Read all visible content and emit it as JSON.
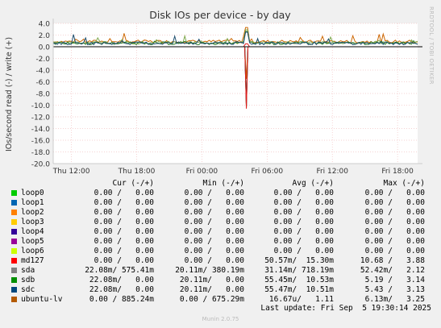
{
  "chart_data": {
    "type": "line",
    "title": "Disk IOs per device - by day",
    "ylabel": "IOs/second read (-) / write (+)",
    "ylim": [
      -20,
      4
    ],
    "yticks": [
      "4.0",
      "2.0",
      "0.0",
      "-2.0",
      "-4.0",
      "-6.0",
      "-8.0",
      "-10.0",
      "-12.0",
      "-14.0",
      "-16.0",
      "-18.0",
      "-20.0"
    ],
    "xticks": [
      "Thu 12:00",
      "Thu 18:00",
      "Fri 00:00",
      "Fri 06:00",
      "Fri 12:00",
      "Fri 18:00"
    ],
    "grid": true,
    "series": [
      {
        "name": "ubuntu-lv",
        "color": "#cc6600",
        "baseline": 0.9,
        "spike": 3.3,
        "dip": -5.5
      },
      {
        "name": "sda",
        "color": "#7fa84d",
        "baseline": 0.7,
        "spike": 2.9,
        "dip": -10.5
      },
      {
        "name": "sdb",
        "color": "#2c7a2c",
        "baseline": 0.6,
        "spike": 2.6,
        "dip": -10.3
      },
      {
        "name": "sdc",
        "color": "#1f4f6f",
        "baseline": 0.6,
        "spike": 2.5,
        "dip": -10.2
      },
      {
        "name": "md127",
        "color": "#e31b1b",
        "baseline": 0.0,
        "spike": 0.5,
        "dip": -10.6
      }
    ],
    "spike_position": 0.53
  },
  "side_text": "RRDTOOL / TOBI OETIKER",
  "legend": {
    "headers": {
      "cur": "Cur (-/+)",
      "min": "Min (-/+)",
      "avg": "Avg (-/+)",
      "max": "Max (-/+)"
    },
    "rows": [
      {
        "name": "loop0",
        "color": "#00cc00",
        "cur": "0.00 /   0.00",
        "min": "0.00 /   0.00",
        "avg": "0.00 /   0.00",
        "max": "0.00 /   0.00"
      },
      {
        "name": "loop1",
        "color": "#0066b3",
        "cur": "0.00 /   0.00",
        "min": "0.00 /   0.00",
        "avg": "0.00 /   0.00",
        "max": "0.00 /   0.00"
      },
      {
        "name": "loop2",
        "color": "#ff8000",
        "cur": "0.00 /   0.00",
        "min": "0.00 /   0.00",
        "avg": "0.00 /   0.00",
        "max": "0.00 /   0.00"
      },
      {
        "name": "loop3",
        "color": "#ffcc00",
        "cur": "0.00 /   0.00",
        "min": "0.00 /   0.00",
        "avg": "0.00 /   0.00",
        "max": "0.00 /   0.00"
      },
      {
        "name": "loop4",
        "color": "#330099",
        "cur": "0.00 /   0.00",
        "min": "0.00 /   0.00",
        "avg": "0.00 /   0.00",
        "max": "0.00 /   0.00"
      },
      {
        "name": "loop5",
        "color": "#990099",
        "cur": "0.00 /   0.00",
        "min": "0.00 /   0.00",
        "avg": "0.00 /   0.00",
        "max": "0.00 /   0.00"
      },
      {
        "name": "loop6",
        "color": "#ccff00",
        "cur": "0.00 /   0.00",
        "min": "0.00 /   0.00",
        "avg": "0.00 /   0.00",
        "max": "0.00 /   0.00"
      },
      {
        "name": "md127",
        "color": "#ff0000",
        "cur": "0.00 /   0.00",
        "min": "0.00 /   0.00",
        "avg": "50.57m/  15.30m",
        "max": "10.68 /   3.88"
      },
      {
        "name": "sda",
        "color": "#808080",
        "cur": "22.08m/ 575.41m",
        "min": "20.11m/ 380.19m",
        "avg": "31.14m/ 718.19m",
        "max": "52.42m/   2.12"
      },
      {
        "name": "sdb",
        "color": "#008f00",
        "cur": "22.08m/   0.00",
        "min": "20.11m/   0.00",
        "avg": "55.45m/  10.53m",
        "max": "5.19 /   3.14"
      },
      {
        "name": "sdc",
        "color": "#00487d",
        "cur": "22.08m/   0.00",
        "min": "20.11m/   0.00",
        "avg": "55.47m/  10.51m",
        "max": "5.43 /   3.13"
      },
      {
        "name": "ubuntu-lv",
        "color": "#b35a00",
        "cur": "0.00 / 885.24m",
        "min": "0.00 / 675.29m",
        "avg": "16.67u/   1.11",
        "max": "6.13m/   3.25"
      }
    ]
  },
  "last_update": "Last update: Fri Sep  5 19:30:14 2025",
  "version": "Munin 2.0.75"
}
